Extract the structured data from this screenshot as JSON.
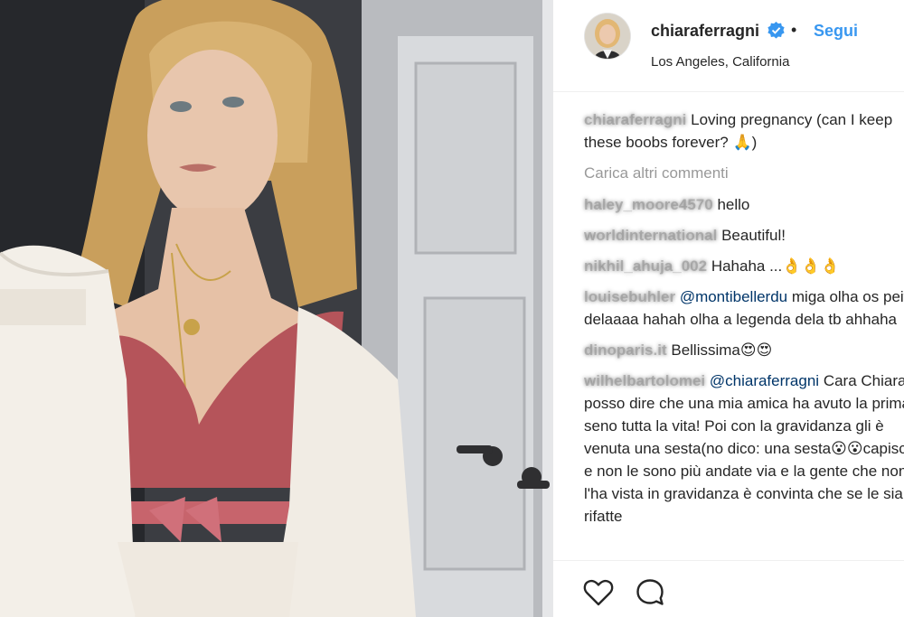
{
  "post": {
    "username": "chiaraferragni",
    "separator": "•",
    "follow_label": "Segui",
    "location": "Los Angeles, California"
  },
  "caption": {
    "author": "chiaraferragni",
    "text": "Loving pregnancy (can I keep these boobs forever? 🙏)"
  },
  "load_more_label": "Carica altri commenti",
  "comments": [
    {
      "author": "haley_moore4570",
      "text": "hello"
    },
    {
      "author": "worldinternational",
      "text": "Beautiful!"
    },
    {
      "author": "nikhil_ahuja_002",
      "text": "Hahaha ...👌👌👌"
    },
    {
      "author": "louisebuhler",
      "mention": "@montibellerdu",
      "text": "miga olha os peitos delaaaa hahah olha a legenda dela tb ahhaha"
    },
    {
      "author": "dinoparis.it",
      "text": "Bellissima😍😍"
    },
    {
      "author": "wilhelbartolomei",
      "mention": "@chiaraferragni",
      "text": "Cara Chiara ti posso dire che una mia amica ha avuto la prima di seno tutta la vita! Poi con la gravidanza gli è venuta una sesta(no dico: una sesta😮😮capisci?) e non le sono più andate via e la gente che non l'ha vista in gravidanza è convinta che se le sia rifatte"
    }
  ],
  "icons": {
    "verified": "verified-badge-icon",
    "like": "heart-icon",
    "comment": "comment-bubble-icon"
  },
  "colors": {
    "link_blue": "#3897f0",
    "mention_blue": "#003569",
    "verified_blue": "#3897f0",
    "text": "#262626",
    "muted": "#999999",
    "divider": "#efefef"
  }
}
